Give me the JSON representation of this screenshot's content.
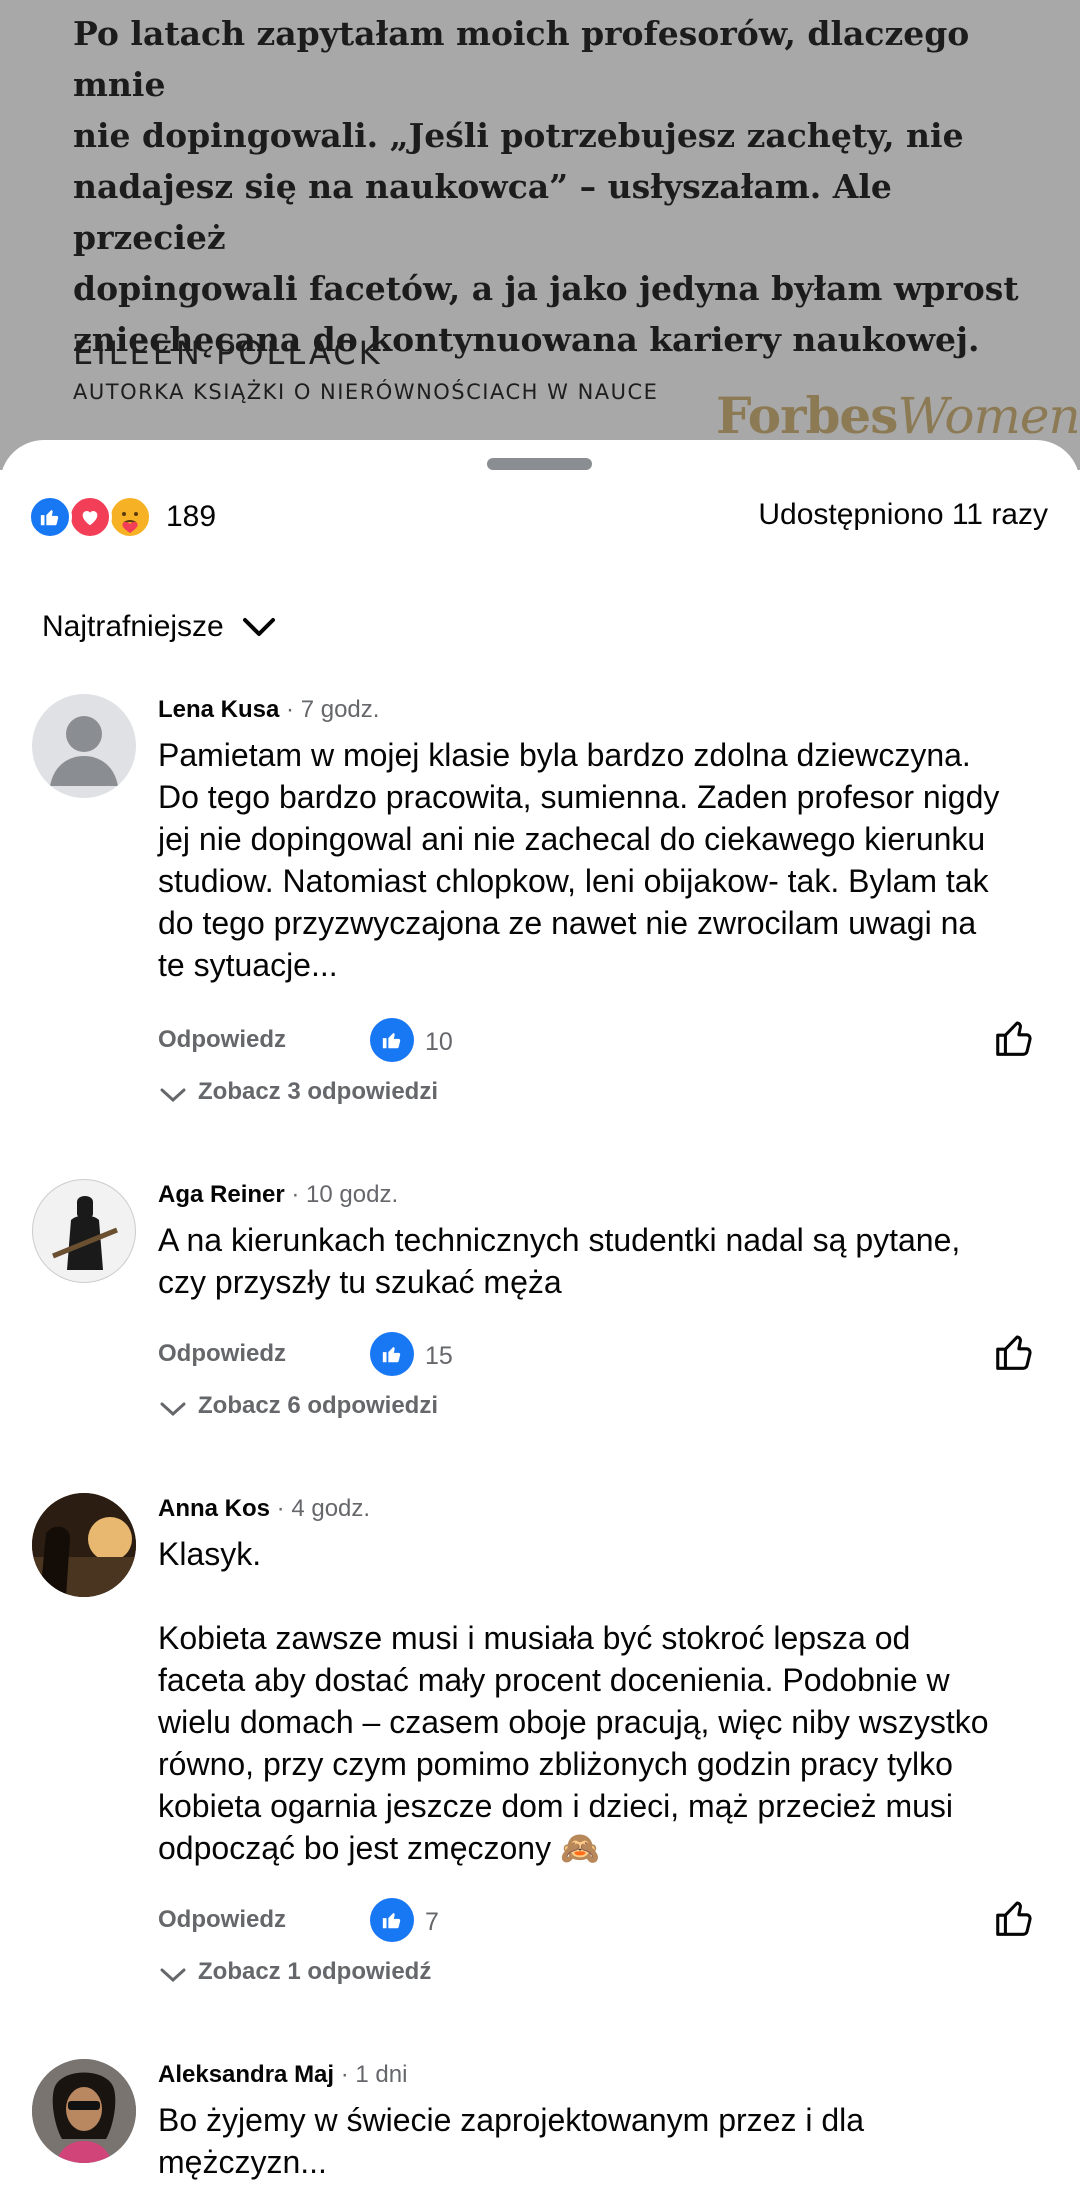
{
  "post": {
    "quote": "Po latach zapytałam moich profesorów, dlaczego mnie\nnie dopingowali. „Jeśli potrzebujesz zachęty, nie\nnadajesz się na naukowca” – usłyszałam. Ale przecież\ndopingowali facetów, a ja jako jedyna byłam wprost\nzniechęcana do kontynuowana kariery naukowej.",
    "author_name": "EILEEN POLLACK",
    "author_desc": "AUTORKA KSIĄŻKI O NIERÓWNOŚCIACH W NAUCE",
    "brand_a": "Forbes",
    "brand_b": "Women"
  },
  "reactions": {
    "icons": [
      "like-icon",
      "love-icon",
      "care-icon"
    ],
    "count": "189",
    "shares": "Udostępniono 11 razy"
  },
  "sort": {
    "label": "Najtrafniejsze"
  },
  "colors": {
    "accent": "#1877f2",
    "secondary_text": "#65676b",
    "dim_overlay": "#a8a8a8",
    "brand_gold": "#8c7a55"
  },
  "comments": [
    {
      "name": "Lena  Kusa",
      "time": " · 7 godz.",
      "text": "Pamietam w mojej klasie byla bardzo zdolna dziewczyna.\nDo tego bardzo pracowita, sumienna. Zaden profesor nigdy\njej nie dopingowal ani nie zachecal do ciekawego kierunku\nstudiow. Natomiast chlopkow, leni obijakow- tak. Bylam tak\ndo tego przyzwyczajona ze nawet nie zwrocilam uwagi na\nte sytuacje...",
      "reply_label": "Odpowiedz",
      "likes": "10",
      "replies_label": "Zobacz 3 odpowiedzi"
    },
    {
      "name": "Aga Reiner",
      "time": " · 10 godz.",
      "text": "A na kierunkach technicznych studentki nadal są pytane,\nczy przyszły tu szukać męża",
      "reply_label": "Odpowiedz",
      "likes": "15",
      "replies_label": "Zobacz 6 odpowiedzi"
    },
    {
      "name": "Anna Kos",
      "time": " · 4 godz.",
      "text": "Klasyk.\n\nKobieta zawsze musi i musiała być stokroć lepsza od\nfaceta aby dostać mały procent docenienia. Podobnie w\nwielu domach – czasem oboje pracują, więc niby wszystko\nrówno, przy czym pomimo zbliżonych godzin pracy tylko\nkobieta ogarnia jeszcze dom i dzieci, mąż przecież musi\nodpocząć bo jest zmęczony 🙈",
      "reply_label": "Odpowiedz",
      "likes": "7",
      "replies_label": "Zobacz 1 odpowiedź"
    },
    {
      "name": "Aleksandra Maj",
      "time": " · 1 dni",
      "text": "Bo żyjemy w świecie zaprojektowanym przez i dla\nmężczyzn..."
    }
  ]
}
